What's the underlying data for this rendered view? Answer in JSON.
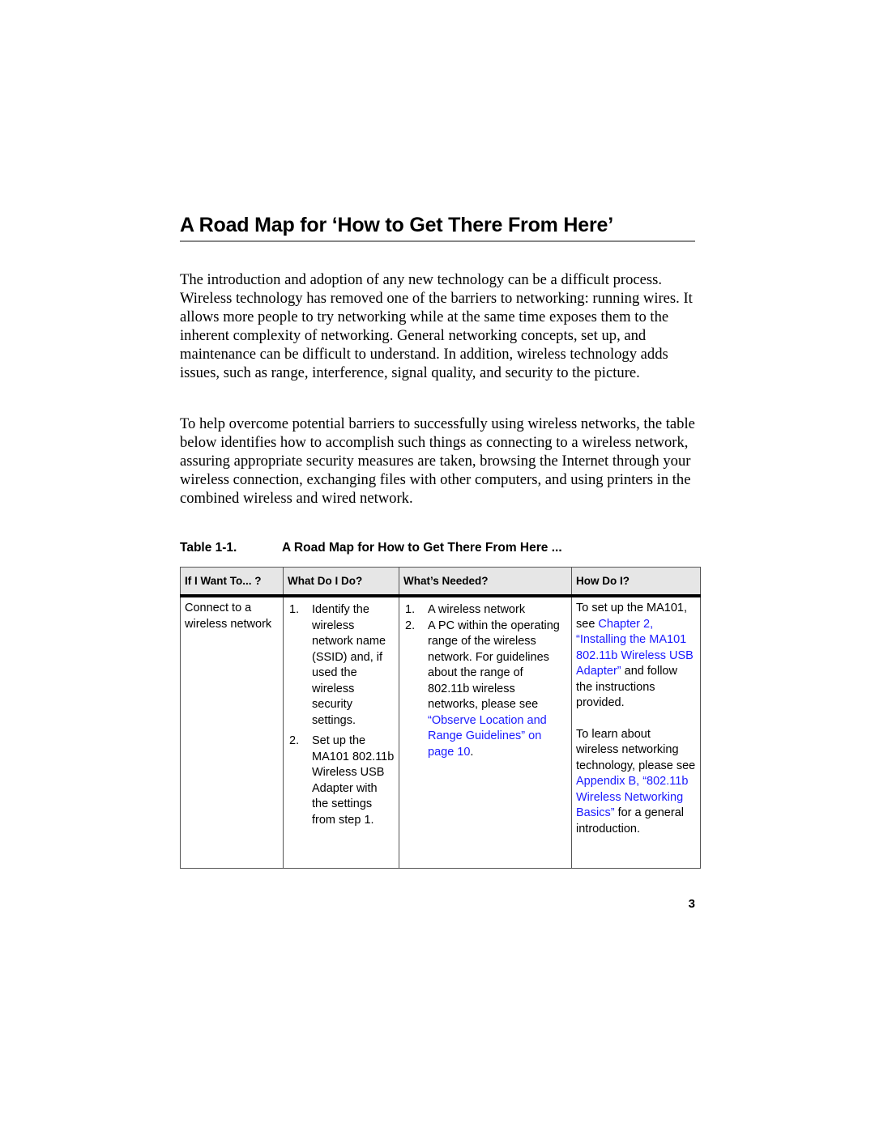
{
  "heading": "A Road Map for ‘How to Get There From Here’",
  "paragraphs": [
    "The introduction and adoption of any new technology can be a difficult process. Wireless technology has removed one of the barriers to networking: running wires. It allows more people to try networking while at the same time exposes them to the inherent complexity of networking. General networking concepts, set up, and maintenance can be difficult to understand. In addition, wireless technology adds issues, such as range, interference, signal quality, and security to the picture.",
    "To help overcome potential barriers to successfully using wireless networks, the table below identifies how to accomplish such things as connecting to a wireless network, assuring appropriate security measures are taken, browsing the Internet through your wireless connection, exchanging files with other computers, and using printers in the combined wireless and wired network."
  ],
  "table": {
    "number": "Table 1-1.",
    "caption": "A Road Map for How to Get There From Here ...",
    "headers": [
      "If I Want To... ?",
      "What Do I Do?",
      "What’s Needed?",
      "How Do I?"
    ],
    "rows": [
      {
        "goal": "Connect to a wireless network",
        "actions": [
          {
            "num": "1.",
            "text": "Identify the wireless network name (SSID) and, if used the wireless security settings."
          },
          {
            "num": "2.",
            "text": "Set up the MA101 802.11b Wireless USB Adapter with the settings from step 1."
          }
        ],
        "needed": [
          {
            "num": "1.",
            "text": "A wireless network"
          },
          {
            "num": "2.",
            "text": "A PC within the operating range of the wireless network. For guidelines about the range of 802.11b wireless networks, please see ",
            "link": "“Observe Location and Range Guidelines” on page 10",
            "after": "."
          }
        ],
        "how": [
          {
            "before": "To set up the MA101, see ",
            "link": "Chapter 2, “Installing the MA101 802.11b Wireless USB Adapter”",
            "after": " and follow the instructions provided."
          },
          {
            "before": "To learn about wireless networking technology, please see ",
            "link": "Appendix B, “802.11b Wireless Networking Basics”",
            "after": " for a general introduction."
          }
        ]
      }
    ]
  },
  "page_number": "3",
  "colors": {
    "link": "#1a1aff",
    "header_bg": "#e6e6e6",
    "rule": "#888888"
  }
}
